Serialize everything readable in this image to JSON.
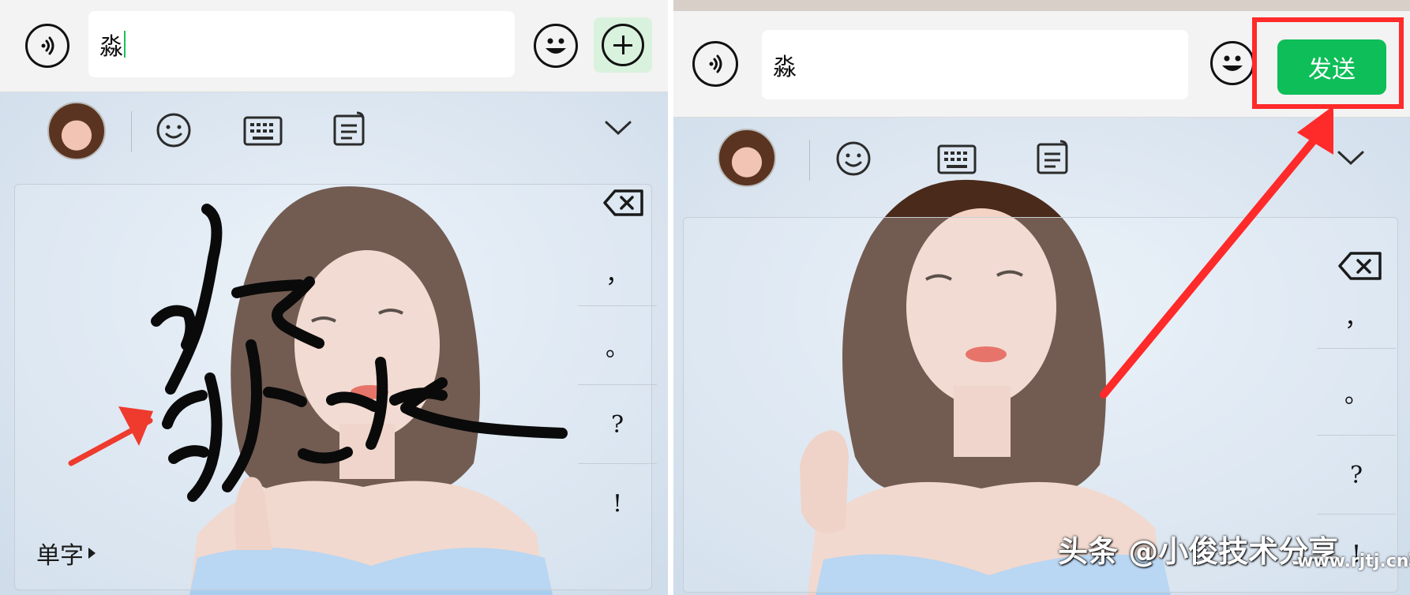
{
  "left_panel": {
    "input": {
      "value": "淼"
    },
    "icons": {
      "voice": "voice-icon",
      "emoji": "emoji-icon",
      "more": "plus-icon"
    },
    "keyboard": {
      "icons": {
        "avatar": "avatar",
        "emoji": "smiley-icon",
        "keyboard": "keyboard-icon",
        "clipboard": "clipboard-icon",
        "collapse": "chevron-down-icon",
        "delete": "backspace-icon"
      },
      "punctuation": [
        "，",
        "。",
        "?",
        "!"
      ],
      "mode_label": "单字"
    },
    "annotation_color": "#ee3b2e",
    "stroke_color": "#0a0a0a"
  },
  "right_panel": {
    "input": {
      "value": "淼"
    },
    "send_button": "发送",
    "icons": {
      "voice": "voice-icon",
      "emoji": "emoji-icon"
    },
    "keyboard": {
      "punctuation": [
        "，",
        "。",
        "?",
        "!"
      ]
    },
    "highlight_color": "#ff2a2a",
    "send_color": "#0ebe58"
  },
  "watermark": {
    "main": "头条 @小俊技术分享",
    "site": "www.rjtj.cn软荐网"
  }
}
